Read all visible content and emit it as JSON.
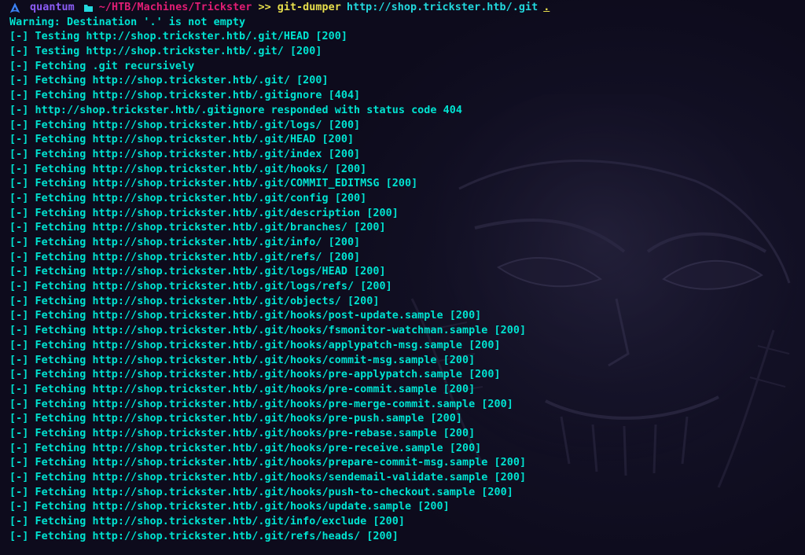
{
  "prompt": {
    "user": "quantum",
    "cwd": "~/HTB/Machines/Trickster",
    "separator": ">>",
    "command": "git-dumper",
    "url_arg": "http://shop.trickster.htb/.git",
    "dest_arg": "."
  },
  "warning": "Warning: Destination '.' is not empty",
  "lines": [
    {
      "tag": "[-]",
      "text": "Testing http://shop.trickster.htb/.git/HEAD [200]"
    },
    {
      "tag": "[-]",
      "text": "Testing http://shop.trickster.htb/.git/ [200]"
    },
    {
      "tag": "[-]",
      "text": "Fetching .git recursively"
    },
    {
      "tag": "[-]",
      "text": "Fetching http://shop.trickster.htb/.git/ [200]"
    },
    {
      "tag": "[-]",
      "text": "Fetching http://shop.trickster.htb/.gitignore [404]"
    },
    {
      "tag": "[-]",
      "text": "http://shop.trickster.htb/.gitignore responded with status code 404"
    },
    {
      "tag": "[-]",
      "text": "Fetching http://shop.trickster.htb/.git/logs/ [200]"
    },
    {
      "tag": "[-]",
      "text": "Fetching http://shop.trickster.htb/.git/HEAD [200]"
    },
    {
      "tag": "[-]",
      "text": "Fetching http://shop.trickster.htb/.git/index [200]"
    },
    {
      "tag": "[-]",
      "text": "Fetching http://shop.trickster.htb/.git/hooks/ [200]"
    },
    {
      "tag": "[-]",
      "text": "Fetching http://shop.trickster.htb/.git/COMMIT_EDITMSG [200]"
    },
    {
      "tag": "[-]",
      "text": "Fetching http://shop.trickster.htb/.git/config [200]"
    },
    {
      "tag": "[-]",
      "text": "Fetching http://shop.trickster.htb/.git/description [200]"
    },
    {
      "tag": "[-]",
      "text": "Fetching http://shop.trickster.htb/.git/branches/ [200]"
    },
    {
      "tag": "[-]",
      "text": "Fetching http://shop.trickster.htb/.git/info/ [200]"
    },
    {
      "tag": "[-]",
      "text": "Fetching http://shop.trickster.htb/.git/refs/ [200]"
    },
    {
      "tag": "[-]",
      "text": "Fetching http://shop.trickster.htb/.git/logs/HEAD [200]"
    },
    {
      "tag": "[-]",
      "text": "Fetching http://shop.trickster.htb/.git/logs/refs/ [200]"
    },
    {
      "tag": "[-]",
      "text": "Fetching http://shop.trickster.htb/.git/objects/ [200]"
    },
    {
      "tag": "[-]",
      "text": "Fetching http://shop.trickster.htb/.git/hooks/post-update.sample [200]"
    },
    {
      "tag": "[-]",
      "text": "Fetching http://shop.trickster.htb/.git/hooks/fsmonitor-watchman.sample [200]"
    },
    {
      "tag": "[-]",
      "text": "Fetching http://shop.trickster.htb/.git/hooks/applypatch-msg.sample [200]"
    },
    {
      "tag": "[-]",
      "text": "Fetching http://shop.trickster.htb/.git/hooks/commit-msg.sample [200]"
    },
    {
      "tag": "[-]",
      "text": "Fetching http://shop.trickster.htb/.git/hooks/pre-applypatch.sample [200]"
    },
    {
      "tag": "[-]",
      "text": "Fetching http://shop.trickster.htb/.git/hooks/pre-commit.sample [200]"
    },
    {
      "tag": "[-]",
      "text": "Fetching http://shop.trickster.htb/.git/hooks/pre-merge-commit.sample [200]"
    },
    {
      "tag": "[-]",
      "text": "Fetching http://shop.trickster.htb/.git/hooks/pre-push.sample [200]"
    },
    {
      "tag": "[-]",
      "text": "Fetching http://shop.trickster.htb/.git/hooks/pre-rebase.sample [200]"
    },
    {
      "tag": "[-]",
      "text": "Fetching http://shop.trickster.htb/.git/hooks/pre-receive.sample [200]"
    },
    {
      "tag": "[-]",
      "text": "Fetching http://shop.trickster.htb/.git/hooks/prepare-commit-msg.sample [200]"
    },
    {
      "tag": "[-]",
      "text": "Fetching http://shop.trickster.htb/.git/hooks/sendemail-validate.sample [200]"
    },
    {
      "tag": "[-]",
      "text": "Fetching http://shop.trickster.htb/.git/hooks/push-to-checkout.sample [200]"
    },
    {
      "tag": "[-]",
      "text": "Fetching http://shop.trickster.htb/.git/hooks/update.sample [200]"
    },
    {
      "tag": "[-]",
      "text": "Fetching http://shop.trickster.htb/.git/info/exclude [200]"
    },
    {
      "tag": "[-]",
      "text": "Fetching http://shop.trickster.htb/.git/refs/heads/ [200]"
    }
  ],
  "colors": {
    "background": "#0d0b1c",
    "output_text": "#00e3d1",
    "user": "#8b5cf6",
    "cwd": "#e11d74",
    "command": "#e8df4c",
    "argument": "#22d8dd",
    "os_icon": "#3b82f6"
  },
  "icons": {
    "os": "arch-linux-icon",
    "directory": "folder-icon"
  }
}
